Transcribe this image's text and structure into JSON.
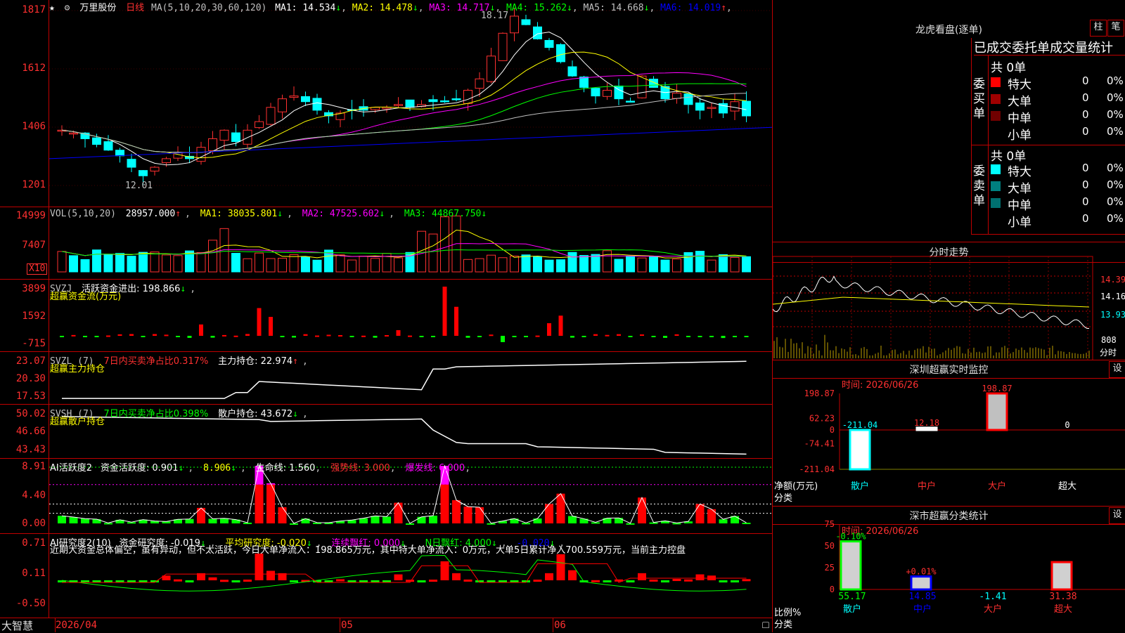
{
  "stock": {
    "name": "万里股份",
    "period": "日线",
    "star": "★",
    "gear": "⚙"
  },
  "main": {
    "ticks": [
      "1817",
      "1612",
      "1406",
      "1201"
    ],
    "ma_label": "MA(5,10,20,30,60,120)",
    "ma": [
      {
        "label": "MA1: 14.534",
        "arrow": "↓",
        "color": "#ffffff"
      },
      {
        "label": "MA2: 14.478",
        "arrow": "↓",
        "color": "#ffff00"
      },
      {
        "label": "MA3: 14.717",
        "arrow": "↓",
        "color": "#ff00ff"
      },
      {
        "label": "MA4: 15.262",
        "arrow": "↓",
        "color": "#00ff00"
      },
      {
        "label": "MA5: 14.668",
        "arrow": "↓",
        "color": "#c0c0c0"
      },
      {
        "label": "MA6: 14.019",
        "arrow": "↑",
        "color": "#0000ff"
      }
    ],
    "high_label": "18.17",
    "low_label": "12.01"
  },
  "vol": {
    "ticks": [
      "14999",
      "7407"
    ],
    "unit": "X10",
    "label": "VOL(5,10,20)",
    "value": "28957.000",
    "ma1": "MA1: 38035.801",
    "ma2": "MA2: 47525.602",
    "ma3": "MA3: 44867.750"
  },
  "svzj": {
    "ticks": [
      "3899",
      "1592",
      "-715"
    ],
    "label": "SVZJ",
    "desc": "活跃资金进出: 198.866",
    "sub": "超赢资金流(万元)"
  },
  "svzl": {
    "ticks": [
      "23.07",
      "20.30",
      "17.53"
    ],
    "label": "SVZL (7)",
    "ratio": "7日内买卖净占比0.317%",
    "hold": "主力持仓: 22.974",
    "sub": "超赢主力持仓"
  },
  "svsh": {
    "ticks": [
      "50.02",
      "46.66",
      "43.43"
    ],
    "label": "SVSH (7)",
    "ratio": "7日内买卖净占比0.398%",
    "hold": "散户持仓: 43.672",
    "sub": "超赢散户持仓"
  },
  "ai1": {
    "ticks": [
      "8.91",
      "4.40",
      "0.00"
    ],
    "label": "AI活跃度2",
    "act": "资金活跃度: 0.901",
    "v2": "8.906",
    "life": "生命线: 1.560",
    "strong": "强势线: 3.000",
    "burst": "爆发线: 6.000"
  },
  "ai2": {
    "ticks": [
      "0.71",
      "0.11",
      "-0.50"
    ],
    "label": "AI研究度2(10)",
    "res": "资金研究度: -0.019",
    "avg": "平均研究度: -0.020",
    "red": "连续飘红: 0.000",
    "n": "N日飘红: 4.000",
    "last": "-0.020",
    "text": "近期大资金总体偏空，虽有异动，但不太活跃，今日大单净流入：198.865万元，其中特大单净流入：0万元，大单5日累计净入700.559万元，当前主力控盘"
  },
  "date_axis": {
    "app": "大智慧",
    "labels": [
      "2026/04",
      "05",
      "06"
    ]
  },
  "lhb": {
    "title": "龙虎看盘(逐单)",
    "btn1": "柱",
    "btn2": "笔",
    "header": "已成交委托单成交量统计",
    "buy_side": "委买单",
    "sell_side": "委卖单",
    "buy_total": "共 0单",
    "sell_total": "共 0单",
    "buy_rows": [
      {
        "name": "特大",
        "count": "0",
        "pct": "0%",
        "color": "#ff0000"
      },
      {
        "name": "大单",
        "count": "0",
        "pct": "0%",
        "color": "#a00000"
      },
      {
        "name": "中单",
        "count": "0",
        "pct": "0%",
        "color": "#700000"
      },
      {
        "name": "小单",
        "count": "0",
        "pct": "0%",
        "color": "#000000"
      }
    ],
    "sell_rows": [
      {
        "name": "特大",
        "count": "0",
        "pct": "0%",
        "color": "#00ffff"
      },
      {
        "name": "大单",
        "count": "0",
        "pct": "0%",
        "color": "#008080"
      },
      {
        "name": "中单",
        "count": "0",
        "pct": "0%",
        "color": "#007070"
      },
      {
        "name": "小单",
        "count": "0",
        "pct": "0%",
        "color": "#000000"
      }
    ]
  },
  "fenshi": {
    "title": "分时走势",
    "ticks": [
      "14.39",
      "14.16",
      "13.93"
    ],
    "vol_tick": "808",
    "vol_unit": "分时"
  },
  "monitor": {
    "title": "深圳超赢实时监控",
    "btn": "设",
    "time": "时间: 2026/06/26",
    "ticks": [
      "198.87",
      "62.23",
      "0",
      "-74.41",
      "-211.04"
    ],
    "ylabel": "净额(万元)",
    "xlabel": "分类",
    "categories": [
      "散户",
      "中户",
      "大户",
      "超大"
    ],
    "values": [
      "-211.04",
      "12.18",
      "198.87",
      "0"
    ]
  },
  "classify": {
    "title": "深市超赢分类统计",
    "btn": "设",
    "time": "时间: 2026/06/26",
    "ticks": [
      "75",
      "50",
      "25",
      "0"
    ],
    "ylabel": "比例%",
    "xlabel": "分类",
    "categories": [
      "散户",
      "中户",
      "大户",
      "超大"
    ],
    "top_labels": [
      "-0.10%",
      "+0.01%",
      "",
      ""
    ],
    "bottom_values": [
      "55.17",
      "14.85",
      "-1.41",
      "31.38"
    ],
    "ratio": [
      55.17,
      14.85,
      0,
      31.38
    ]
  },
  "chart_data": {
    "type": "bar",
    "title": "深圳超赢实时监控",
    "categories": [
      "散户",
      "中户",
      "大户",
      "超大"
    ],
    "series": [
      {
        "name": "净额(万元)",
        "values": [
          -211.04,
          12.18,
          198.87,
          0
        ]
      }
    ],
    "ylim": [
      -211.04,
      198.87
    ],
    "ylabel": "净额(万元)",
    "xlabel": "分类"
  }
}
